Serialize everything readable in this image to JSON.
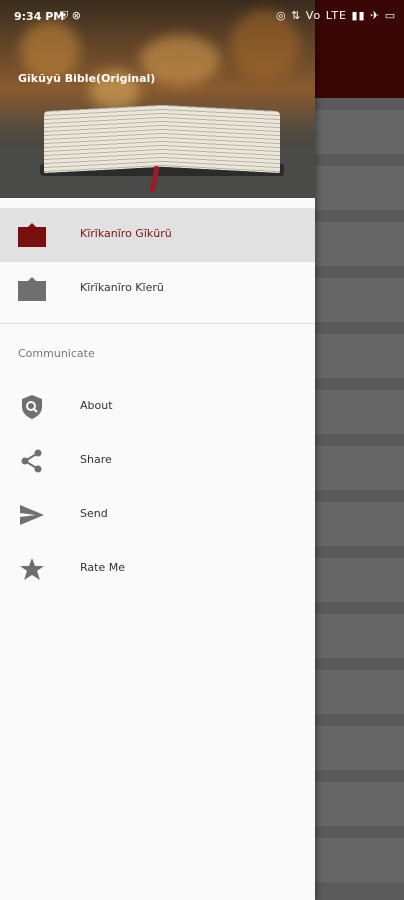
{
  "status_bar": {
    "time": "9:34 PM",
    "left_icons": "⛨ ⊗",
    "right_icons": "◎ ⇅ Vo LTE ▮▮ ✈ ▭"
  },
  "header": {
    "app_title": "Gĩkũyũ Bible(Original)"
  },
  "menu": {
    "items": [
      {
        "label": "Kĩrĩkanĩro Gĩkũrũ",
        "icon": "book-icon",
        "active": true
      },
      {
        "label": "Kĩrĩkanĩro Kĩerũ",
        "icon": "book-icon",
        "active": false
      }
    ]
  },
  "communicate": {
    "section_label": "Communicate",
    "items": [
      {
        "label": "About",
        "icon": "shield-search-icon"
      },
      {
        "label": "Share",
        "icon": "share-icon"
      },
      {
        "label": "Send",
        "icon": "send-icon"
      },
      {
        "label": "Rate Me",
        "icon": "star-icon"
      }
    ]
  },
  "colors": {
    "accent": "#7a1414",
    "active_bg": "#e1e1e1",
    "toolbar": "#3a0606"
  }
}
